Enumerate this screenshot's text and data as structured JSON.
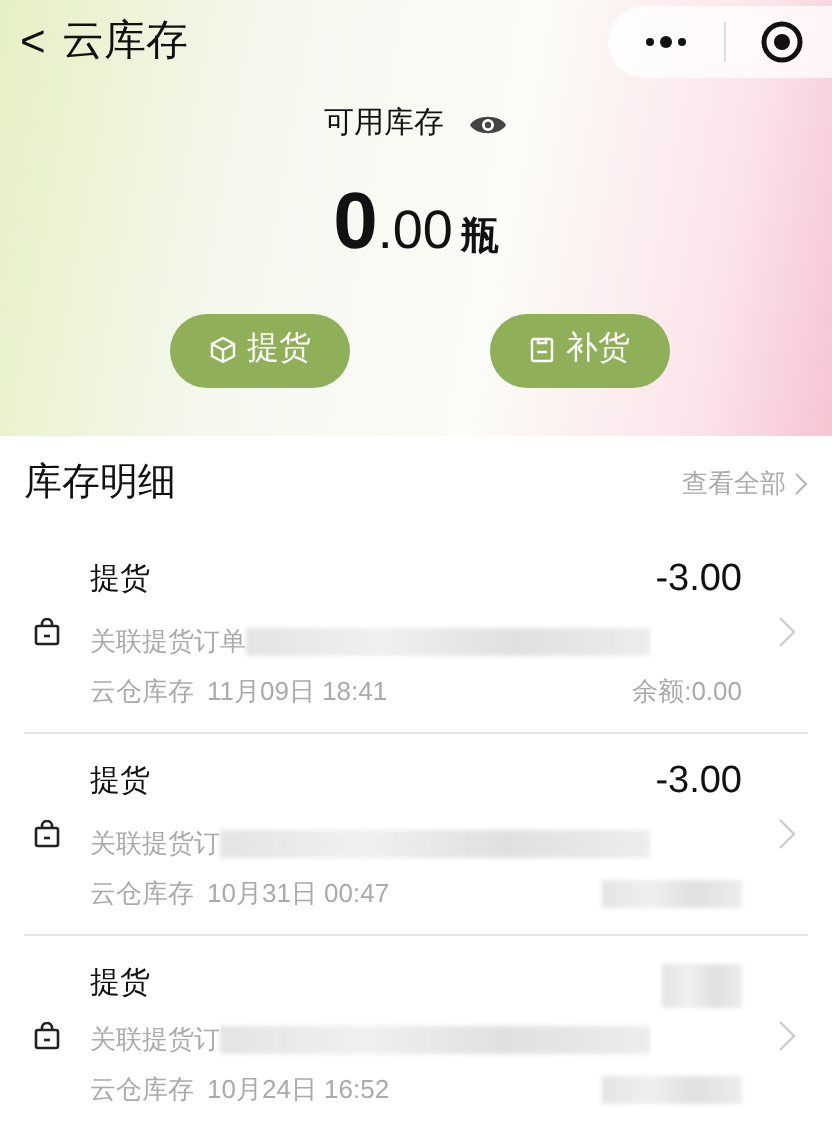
{
  "header": {
    "back": "<",
    "title": "云库存"
  },
  "stock": {
    "label": "可用库存",
    "integer": "0",
    "decimals": ".00",
    "unit": "瓶"
  },
  "actions": [
    {
      "kind": "box",
      "label": "提货"
    },
    {
      "kind": "clipboard",
      "label": "补货"
    }
  ],
  "details": {
    "title": "库存明细",
    "view_all": "查看全部"
  },
  "records": [
    {
      "type": "提货",
      "amount": "-3.00",
      "amount_hidden": false,
      "order": "关联提货订单",
      "source": "云仓库存",
      "date": "11月09日 18:41",
      "balance": "余额:0.00",
      "balance_hidden": false
    },
    {
      "type": "提货",
      "amount": "-3.00",
      "amount_hidden": false,
      "order": "关联提货订",
      "source": "云仓库存",
      "date": "10月31日 00:47",
      "balance_hidden": true
    },
    {
      "type": "提货",
      "amount_hidden": true,
      "order": "关联提货订",
      "source": "云仓库存",
      "date": "10月24日 16:52",
      "balance_hidden": true
    }
  ]
}
